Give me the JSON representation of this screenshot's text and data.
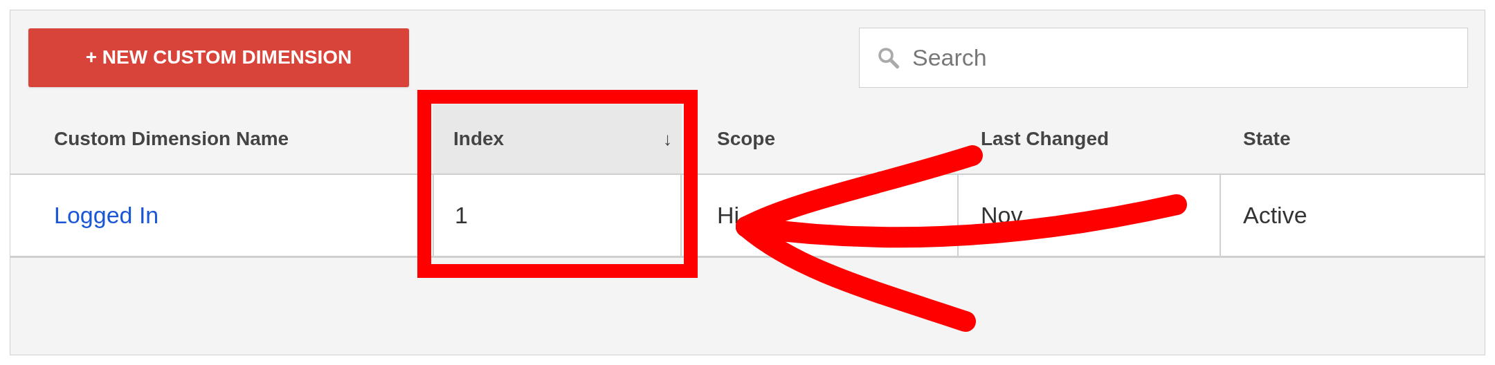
{
  "toolbar": {
    "new_button": "+ NEW CUSTOM DIMENSION",
    "search": {
      "placeholder": "Search"
    }
  },
  "table": {
    "columns": [
      {
        "label": "Custom Dimension Name",
        "sorted": false
      },
      {
        "label": "Index",
        "sorted": true,
        "sort_icon": "↓"
      },
      {
        "label": "Scope",
        "sorted": false
      },
      {
        "label": "Last Changed",
        "sorted": false
      },
      {
        "label": "State",
        "sorted": false
      }
    ],
    "rows": [
      {
        "cells": [
          "Logged In",
          "1",
          "Hi",
          "Nov",
          "Active"
        ]
      }
    ]
  }
}
